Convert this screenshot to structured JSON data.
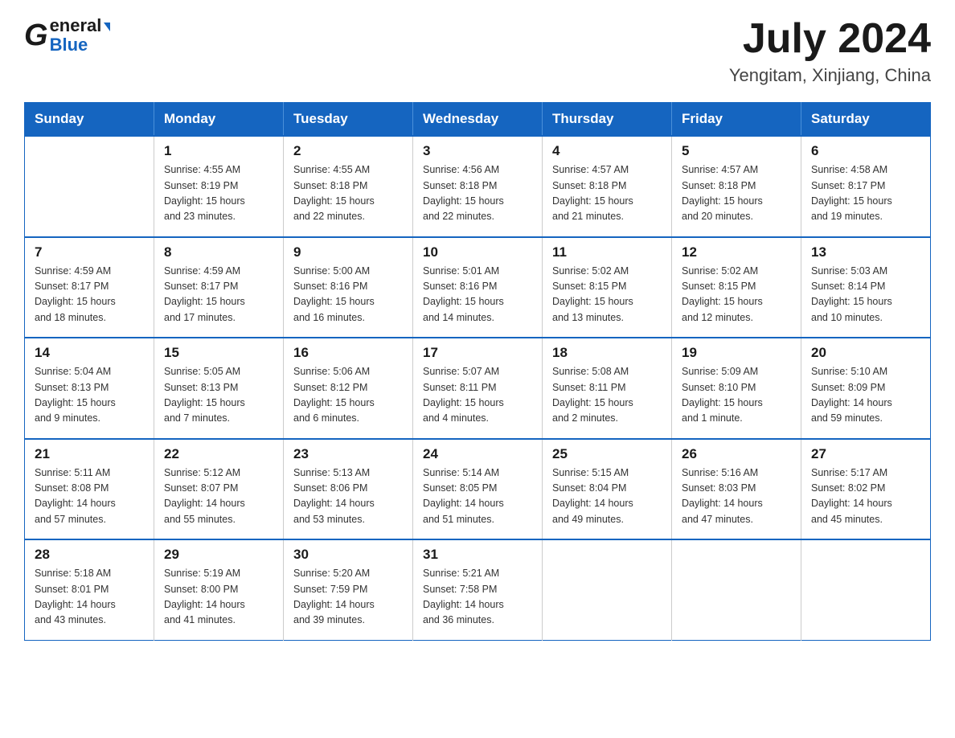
{
  "header": {
    "logo_line1": "General",
    "logo_line2": "Blue",
    "month_title": "July 2024",
    "location": "Yengitam, Xinjiang, China"
  },
  "calendar": {
    "days_of_week": [
      "Sunday",
      "Monday",
      "Tuesday",
      "Wednesday",
      "Thursday",
      "Friday",
      "Saturday"
    ],
    "weeks": [
      [
        {
          "day": "",
          "info": ""
        },
        {
          "day": "1",
          "info": "Sunrise: 4:55 AM\nSunset: 8:19 PM\nDaylight: 15 hours\nand 23 minutes."
        },
        {
          "day": "2",
          "info": "Sunrise: 4:55 AM\nSunset: 8:18 PM\nDaylight: 15 hours\nand 22 minutes."
        },
        {
          "day": "3",
          "info": "Sunrise: 4:56 AM\nSunset: 8:18 PM\nDaylight: 15 hours\nand 22 minutes."
        },
        {
          "day": "4",
          "info": "Sunrise: 4:57 AM\nSunset: 8:18 PM\nDaylight: 15 hours\nand 21 minutes."
        },
        {
          "day": "5",
          "info": "Sunrise: 4:57 AM\nSunset: 8:18 PM\nDaylight: 15 hours\nand 20 minutes."
        },
        {
          "day": "6",
          "info": "Sunrise: 4:58 AM\nSunset: 8:17 PM\nDaylight: 15 hours\nand 19 minutes."
        }
      ],
      [
        {
          "day": "7",
          "info": "Sunrise: 4:59 AM\nSunset: 8:17 PM\nDaylight: 15 hours\nand 18 minutes."
        },
        {
          "day": "8",
          "info": "Sunrise: 4:59 AM\nSunset: 8:17 PM\nDaylight: 15 hours\nand 17 minutes."
        },
        {
          "day": "9",
          "info": "Sunrise: 5:00 AM\nSunset: 8:16 PM\nDaylight: 15 hours\nand 16 minutes."
        },
        {
          "day": "10",
          "info": "Sunrise: 5:01 AM\nSunset: 8:16 PM\nDaylight: 15 hours\nand 14 minutes."
        },
        {
          "day": "11",
          "info": "Sunrise: 5:02 AM\nSunset: 8:15 PM\nDaylight: 15 hours\nand 13 minutes."
        },
        {
          "day": "12",
          "info": "Sunrise: 5:02 AM\nSunset: 8:15 PM\nDaylight: 15 hours\nand 12 minutes."
        },
        {
          "day": "13",
          "info": "Sunrise: 5:03 AM\nSunset: 8:14 PM\nDaylight: 15 hours\nand 10 minutes."
        }
      ],
      [
        {
          "day": "14",
          "info": "Sunrise: 5:04 AM\nSunset: 8:13 PM\nDaylight: 15 hours\nand 9 minutes."
        },
        {
          "day": "15",
          "info": "Sunrise: 5:05 AM\nSunset: 8:13 PM\nDaylight: 15 hours\nand 7 minutes."
        },
        {
          "day": "16",
          "info": "Sunrise: 5:06 AM\nSunset: 8:12 PM\nDaylight: 15 hours\nand 6 minutes."
        },
        {
          "day": "17",
          "info": "Sunrise: 5:07 AM\nSunset: 8:11 PM\nDaylight: 15 hours\nand 4 minutes."
        },
        {
          "day": "18",
          "info": "Sunrise: 5:08 AM\nSunset: 8:11 PM\nDaylight: 15 hours\nand 2 minutes."
        },
        {
          "day": "19",
          "info": "Sunrise: 5:09 AM\nSunset: 8:10 PM\nDaylight: 15 hours\nand 1 minute."
        },
        {
          "day": "20",
          "info": "Sunrise: 5:10 AM\nSunset: 8:09 PM\nDaylight: 14 hours\nand 59 minutes."
        }
      ],
      [
        {
          "day": "21",
          "info": "Sunrise: 5:11 AM\nSunset: 8:08 PM\nDaylight: 14 hours\nand 57 minutes."
        },
        {
          "day": "22",
          "info": "Sunrise: 5:12 AM\nSunset: 8:07 PM\nDaylight: 14 hours\nand 55 minutes."
        },
        {
          "day": "23",
          "info": "Sunrise: 5:13 AM\nSunset: 8:06 PM\nDaylight: 14 hours\nand 53 minutes."
        },
        {
          "day": "24",
          "info": "Sunrise: 5:14 AM\nSunset: 8:05 PM\nDaylight: 14 hours\nand 51 minutes."
        },
        {
          "day": "25",
          "info": "Sunrise: 5:15 AM\nSunset: 8:04 PM\nDaylight: 14 hours\nand 49 minutes."
        },
        {
          "day": "26",
          "info": "Sunrise: 5:16 AM\nSunset: 8:03 PM\nDaylight: 14 hours\nand 47 minutes."
        },
        {
          "day": "27",
          "info": "Sunrise: 5:17 AM\nSunset: 8:02 PM\nDaylight: 14 hours\nand 45 minutes."
        }
      ],
      [
        {
          "day": "28",
          "info": "Sunrise: 5:18 AM\nSunset: 8:01 PM\nDaylight: 14 hours\nand 43 minutes."
        },
        {
          "day": "29",
          "info": "Sunrise: 5:19 AM\nSunset: 8:00 PM\nDaylight: 14 hours\nand 41 minutes."
        },
        {
          "day": "30",
          "info": "Sunrise: 5:20 AM\nSunset: 7:59 PM\nDaylight: 14 hours\nand 39 minutes."
        },
        {
          "day": "31",
          "info": "Sunrise: 5:21 AM\nSunset: 7:58 PM\nDaylight: 14 hours\nand 36 minutes."
        },
        {
          "day": "",
          "info": ""
        },
        {
          "day": "",
          "info": ""
        },
        {
          "day": "",
          "info": ""
        }
      ]
    ]
  }
}
